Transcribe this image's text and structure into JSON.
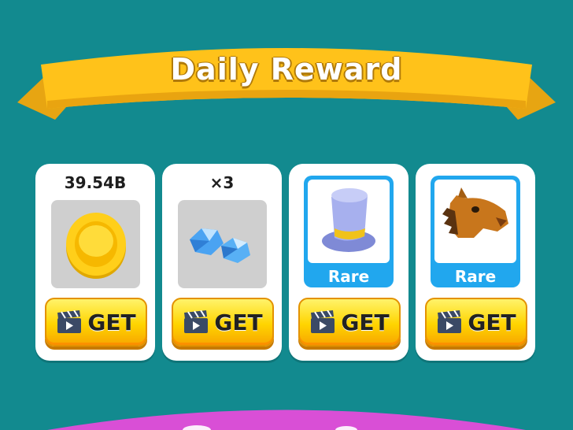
{
  "banner": {
    "title": "Daily Reward"
  },
  "rewards": [
    {
      "amount": "39.54B",
      "icon": "gold-coin",
      "button_label": "GET"
    },
    {
      "amount": "×3",
      "icon": "blue-diamonds",
      "button_label": "GET"
    },
    {
      "rarity": "Rare",
      "icon": "blue-top-hat",
      "button_label": "GET"
    },
    {
      "rarity": "Rare",
      "icon": "horse-head-mask",
      "button_label": "GET"
    }
  ],
  "colors": {
    "background": "#128a8f",
    "ribbon": "#ffc21a",
    "button": "#ffd400",
    "rare_frame": "#21a7ee",
    "bottom_banner": "#d94fd6"
  }
}
